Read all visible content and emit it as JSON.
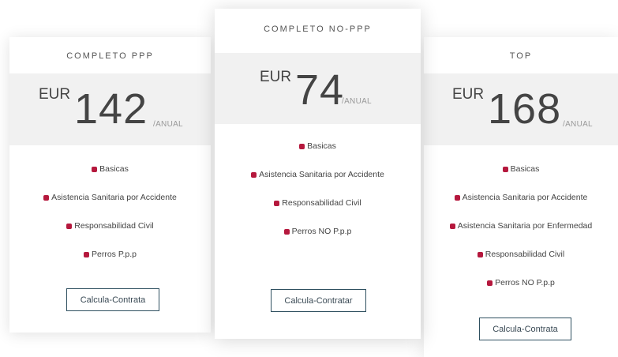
{
  "plans": [
    {
      "name": "COMPLETO PPP",
      "currency": "EUR",
      "amount": "142",
      "period": "/ANUAL",
      "features": [
        "Basicas",
        "Asistencia Sanitaria por Accidente",
        "Responsabilidad Civil",
        "Perros P.p.p"
      ],
      "cta": "Calcula-Contrata"
    },
    {
      "name": "COMPLETO NO-PPP",
      "currency": "EUR",
      "amount": "74",
      "period": "/ANUAL",
      "features": [
        "Basicas",
        "Asistencia Sanitaria por Accidente",
        "Responsabilidad Civil",
        "Perros NO P.p.p"
      ],
      "cta": "Calcula-Contratar"
    },
    {
      "name": "TOP",
      "currency": "EUR",
      "amount": "168",
      "period": "/ANUAL",
      "features": [
        "Basicas",
        "Asistencia Sanitaria por Accidente",
        "Asistencia Sanitaria por Enfermedad",
        "Responsabilidad Civil",
        "Perros NO P.p.p"
      ],
      "cta": "Calcula-Contrata"
    }
  ],
  "colors": {
    "bullet": "#b5183d",
    "button_border": "#2f5060",
    "price_band": "#f1f1f1"
  },
  "icons": {
    "feature_bullet": "square-bullet-icon"
  }
}
